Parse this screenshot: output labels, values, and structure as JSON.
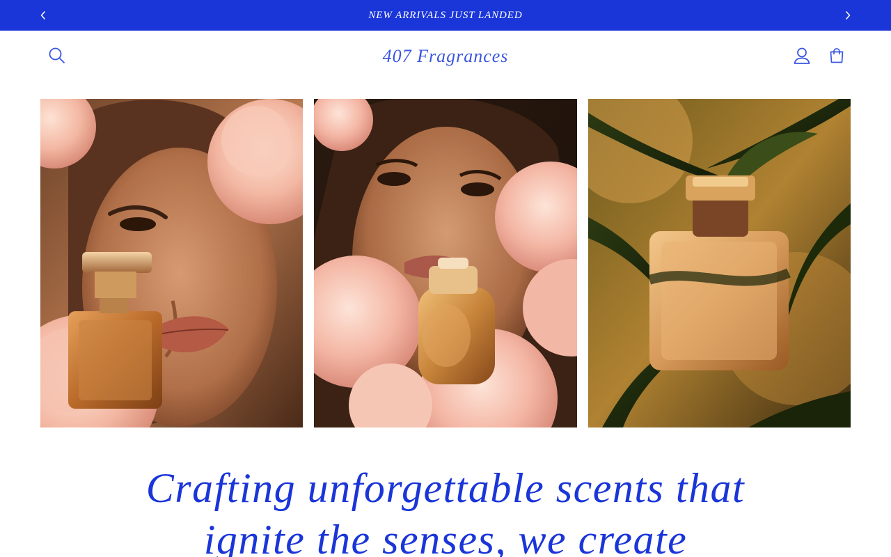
{
  "announcement": {
    "text": "NEW ARRIVALS JUST LANDED",
    "prev_icon": "chevron-left-icon",
    "next_icon": "chevron-right-icon"
  },
  "header": {
    "logo": "407 Fragrances",
    "icons": [
      "search-icon",
      "account-icon",
      "cart-icon"
    ]
  },
  "gallery": [
    {
      "subject": "woman with peonies holding perfume bottle"
    },
    {
      "subject": "woman among pink peonies with perfume bottle"
    },
    {
      "subject": "perfume bottle among green leaves"
    }
  ],
  "hero": {
    "line1": "Crafting unforgettable scents that",
    "line2": "ignite the senses, we create"
  },
  "colors": {
    "brand_blue": "#1a35d8",
    "logo_blue": "#3a55e0",
    "background": "#ffffff"
  }
}
